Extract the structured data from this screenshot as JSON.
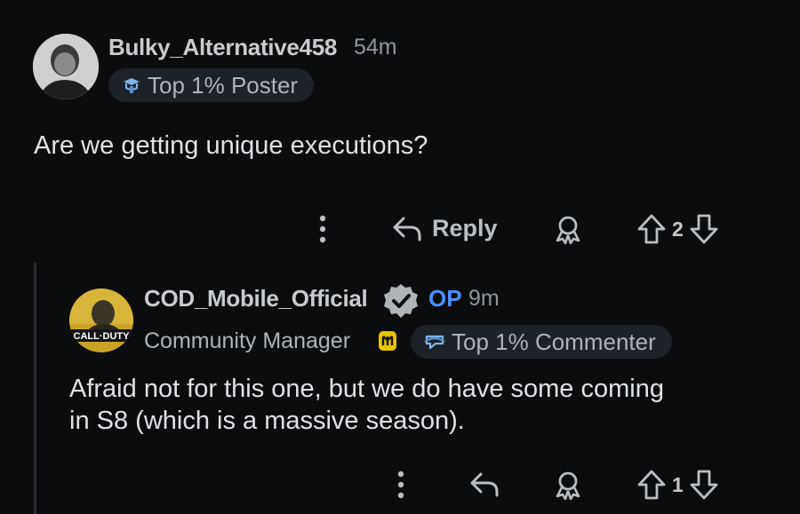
{
  "comments": [
    {
      "username": "Bulky_Alternative458",
      "time": "54m",
      "flair": "Top 1% Poster",
      "flair_icon": "poster-badge-icon",
      "body": "Are we getting unique executions?",
      "actions": {
        "reply_label": "Reply",
        "score": "2"
      }
    },
    {
      "username": "COD_Mobile_Official",
      "op_label": "OP",
      "time": "9m",
      "role": "Community Manager",
      "flair": "Top 1% Commenter",
      "flair_icon": "commenter-badge-icon",
      "avatar_text": "CALL·DUTY",
      "body_lines": [
        "Afraid not for this one, but we do have some coming",
        "in S8 (which is a massive season)."
      ],
      "actions": {
        "score": "1"
      }
    }
  ],
  "colors": {
    "background": "#0b0c0e",
    "op": "#4a90ff",
    "flair_bg": "#1c2227",
    "thread_line": "#2a2e33"
  }
}
